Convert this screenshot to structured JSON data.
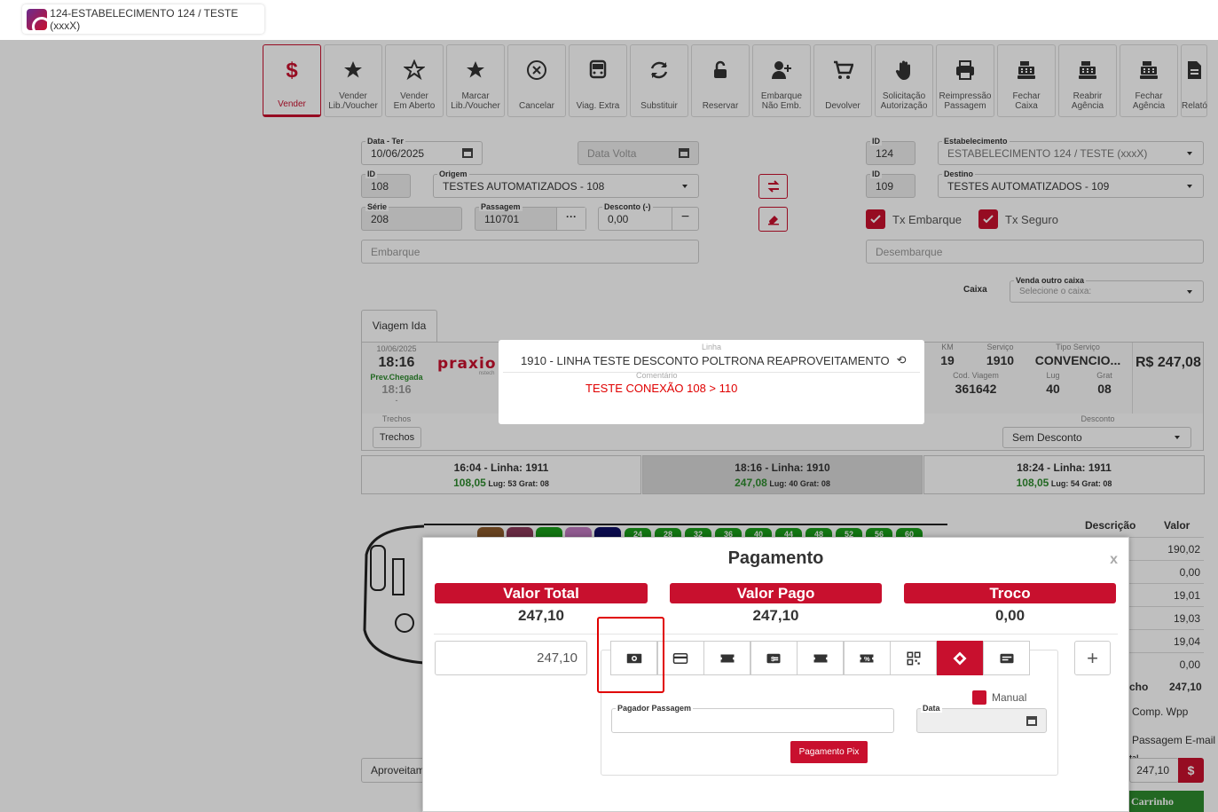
{
  "window": {
    "title": "124-ESTABELECIMENTO 124 / TESTE (xxxX)"
  },
  "toolbar": [
    {
      "name": "vender-button",
      "icon": "dollar-icon",
      "label": "Vender",
      "active": true
    },
    {
      "name": "vender-lib-voucher-button",
      "icon": "star-plus-icon",
      "label": "Vender\nLib./Voucher"
    },
    {
      "name": "vender-em-aberto-button",
      "icon": "star-outline-icon",
      "label": "Vender\nEm Aberto"
    },
    {
      "name": "marcar-lib-voucher-button",
      "icon": "star-filled-icon",
      "label": "Marcar\nLib./Voucher"
    },
    {
      "name": "cancelar-button",
      "icon": "cancel-circle-icon",
      "label": "Cancelar"
    },
    {
      "name": "viag-extra-button",
      "icon": "bus-icon",
      "label": "Viag. Extra"
    },
    {
      "name": "substituir-button",
      "icon": "refresh-icon",
      "label": "Substituir"
    },
    {
      "name": "reservar-button",
      "icon": "unlock-icon",
      "label": "Reservar"
    },
    {
      "name": "embarque-nao-emb-button",
      "icon": "user-plus-icon",
      "label": "Embarque\nNão Emb."
    },
    {
      "name": "devolver-button",
      "icon": "cart-return-icon",
      "label": "Devolver"
    },
    {
      "name": "solicitacao-autorizacao-button",
      "icon": "hand-icon",
      "label": "Solicitação\nAutorização"
    },
    {
      "name": "reimpressao-passagem-button",
      "icon": "printer-icon",
      "label": "Reimpressão\nPassagem"
    },
    {
      "name": "fechar-caixa-button",
      "icon": "cash-register-icon",
      "label": "Fechar\nCaixa"
    },
    {
      "name": "reabrir-agencia-button",
      "icon": "cash-register-icon",
      "label": "Reabrir\nAgência"
    },
    {
      "name": "fechar-agencia-button",
      "icon": "cash-register-icon",
      "label": "Fechar\nAgência"
    },
    {
      "name": "relatorio-button",
      "icon": "document-icon",
      "label": "Relató"
    }
  ],
  "form": {
    "data_label": "Data - Ter",
    "data_value": "10/06/2025",
    "data_volta_placeholder": "Data Volta",
    "id_label": "ID",
    "origem_id": "108",
    "origem_label": "Origem",
    "origem_value": "TESTES AUTOMATIZADOS - 108",
    "serie_label": "Série",
    "serie_value": "208",
    "passagem_label": "Passagem",
    "passagem_value": "110701",
    "desconto_label": "Desconto (-)",
    "desconto_value": "0,00",
    "embarque_placeholder": "Embarque",
    "estab_id": "124",
    "estab_label": "Estabelecimento",
    "estab_value": "ESTABELECIMENTO 124 / TESTE (xxxX)",
    "destino_id": "109",
    "destino_label": "Destino",
    "destino_value": "TESTES AUTOMATIZADOS - 109",
    "tx_embarque": "Tx Embarque",
    "tx_seguro": "Tx Seguro",
    "desembarque_placeholder": "Desembarque",
    "caixa_label": "Caixa",
    "venda_outro_caixa_label": "Venda outro caixa",
    "venda_outro_caixa_placeholder": "Selecione o caixa:"
  },
  "trip": {
    "tab": "Viagem Ida",
    "date": "10/06/2025",
    "time": "18:16",
    "prev_chegada_label": "Prev.Chegada",
    "prev_chegada": "18:16",
    "dot": "-",
    "logo": "praxio",
    "logo_sub": "nstech",
    "linha_label": "Linha",
    "linha": "1910 - LINHA TESTE DESCONTO POLTRONA REAPROVEITAMENTO",
    "comentario_label": "Comentário",
    "comentario": "TESTE CONEXÃO 108 > 110",
    "km_label": "KM",
    "km": "19",
    "servico_label": "Serviço",
    "servico": "1910",
    "tipo_servico_label": "Tipo Serviço",
    "tipo_servico": "CONVENCIO...",
    "cod_viagem_label": "Cod. Viagem",
    "cod_viagem": "361642",
    "lug_label": "Lug",
    "lug": "40",
    "grat_label": "Grat",
    "grat": "08",
    "price": "R$ 247,08",
    "trechos_label": "Trechos",
    "trechos_button": "Trechos",
    "desconto_label": "Desconto",
    "desconto_value": "Sem Desconto"
  },
  "schedules": [
    {
      "title": "16:04 - Linha: 1911",
      "price": "108,05",
      "info": "Lug: 53 Grat: 08",
      "selected": false
    },
    {
      "title": "18:16 - Linha: 1910",
      "price": "247,08",
      "info": "Lug: 40 Grat: 08",
      "selected": true
    },
    {
      "title": "18:24 - Linha: 1911",
      "price": "108,05",
      "info": "Lug: 54 Grat: 08",
      "selected": false
    }
  ],
  "seats": [
    "24",
    "28",
    "32",
    "36",
    "40",
    "44",
    "48",
    "52",
    "56",
    "60"
  ],
  "summary": {
    "descricao_header": "Descrição",
    "valor_header": "Valor",
    "values": [
      "190,02",
      "0,00",
      "19,01",
      "19,03",
      "19,04",
      "0,00"
    ],
    "total_label": "cho",
    "total_value": "247,10",
    "comp_wpp": "Comp. Wpp",
    "passagem_email": "Passagem E-mail",
    "total_small_label": "tal",
    "total_field": "247,10",
    "carrinho": "Carrinho"
  },
  "aproveitamento": "Aproveitam",
  "modal": {
    "title": "Pagamento",
    "close": "x",
    "valor_total_label": "Valor Total",
    "valor_total": "247,10",
    "valor_pago_label": "Valor Pago",
    "valor_pago": "247,10",
    "troco_label": "Troco",
    "troco": "0,00",
    "amount": "247,10",
    "payment_methods": [
      "cash-icon",
      "credit-card-icon",
      "ticket-icon",
      "dollar-card-icon",
      "voucher-icon",
      "percent-ticket-icon",
      "qr-code-icon",
      "pix-icon",
      "id-card-icon"
    ],
    "manual_label": "Manual",
    "pagador_label": "Pagador Passagem",
    "data_label": "Data",
    "pix_button": "Pagamento Pix",
    "add_button": "+"
  },
  "colors": {
    "accent": "#c8102e",
    "green": "#2e8b2e",
    "selected_bg": "#d9d9d9"
  }
}
